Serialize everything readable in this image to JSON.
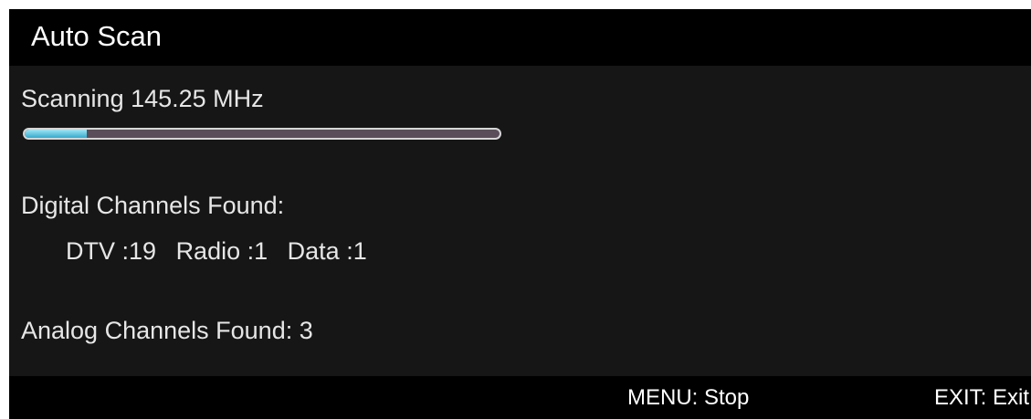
{
  "title": "Auto Scan",
  "scan": {
    "status": "Scanning 145.25 MHz",
    "progress_percent": 13
  },
  "digital": {
    "label": "Digital Channels Found:",
    "dtv": "DTV :19",
    "radio": "Radio :1",
    "data": "Data :1"
  },
  "analog": {
    "label": "Analog Channels Found: 3"
  },
  "footer": {
    "menu_hint": "MENU: Stop",
    "exit_hint": "EXIT: Exit"
  },
  "colors": {
    "background": "#161616",
    "bar": "#000000",
    "text": "#e6e6e6",
    "progress_fill": "#35a9cc",
    "progress_track": "#5b4d5a"
  }
}
